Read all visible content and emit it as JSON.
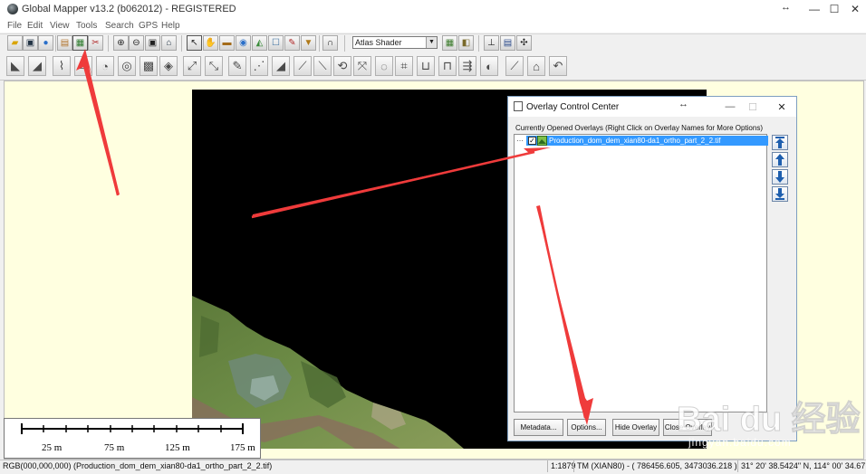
{
  "window": {
    "title": "Global Mapper v13.2 (b062012) - REGISTERED",
    "controls": [
      "—",
      "☐",
      "✕"
    ]
  },
  "menu": [
    "File",
    "Edit",
    "View",
    "Tools",
    "Search",
    "GPS",
    "Help"
  ],
  "toolbar": {
    "shader_value": "Atlas Shader",
    "row1_icons": [
      "open-folder-icon",
      "save-icon",
      "globe-icon",
      "map-book-icon",
      "overlay-control-center-icon",
      "tools-icon",
      "zoom-in-icon",
      "zoom-out-icon",
      "full-view-icon",
      "home-icon",
      "select-icon",
      "pan-icon",
      "measure-icon",
      "elevation-icon",
      "3d-view-icon",
      "shadow-icon",
      "digitize-icon",
      "feature-info-icon",
      "path-profile-icon",
      "lidar-icon",
      "view-shed-icon",
      "coordinates-icon",
      "query-icon",
      "gps-icon"
    ],
    "row2_icon_count": 30
  },
  "map": {
    "background_color": "#ffffe0",
    "scale_labels": [
      "25 m",
      "75 m",
      "125 m",
      "175 m"
    ]
  },
  "overlay_control_center": {
    "title": "Overlay Control Center",
    "caption": "Currently Opened Overlays (Right Click on Overlay Names for More Options)",
    "overlay_name": "Production_dom_dem_xian80-da1_ortho_part_2_2.tif",
    "overlay_checked": true,
    "buttons": {
      "metadata": "Metadata...",
      "options": "Options...",
      "hide_overlay": "Hide Overlay",
      "close_overlay": "Close Overlay"
    },
    "order_buttons": [
      "move-to-top-icon",
      "move-up-icon",
      "move-down-icon",
      "move-to-bottom-icon"
    ],
    "window_controls": [
      "—",
      "☐",
      "✕"
    ]
  },
  "status_bar": {
    "layer_info": "RGB(000,000,000) (Production_dom_dem_xian80-da1_ortho_part_2_2.tif)",
    "scale": "1:1879",
    "projection": "TM (XIAN80) - ( 786456.605, 3473036.218 )",
    "lat_lon": "31° 20' 38.5424\" N, 114° 00' 34.67"
  },
  "watermark": {
    "logo_text": "Bai du 经验",
    "sub_text": "jingyan.baidu.com"
  },
  "colors": {
    "selection": "#3399ff",
    "annotation_arrow": "#ef3b3b",
    "map_background": "#ffffe0"
  }
}
